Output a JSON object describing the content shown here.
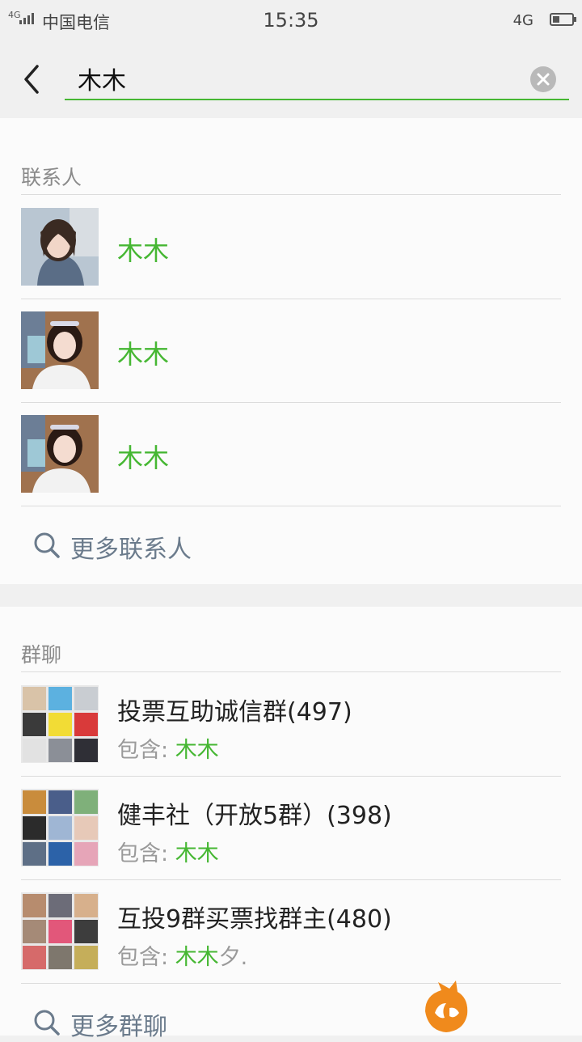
{
  "status_bar": {
    "signal": "4G",
    "carrier": "中国电信",
    "time": "15:35",
    "network": "4G"
  },
  "search": {
    "query": "木木",
    "back_icon": "back-arrow-icon",
    "clear_icon": "clear-icon"
  },
  "contacts": {
    "title": "联系人",
    "items": [
      {
        "name": "木木"
      },
      {
        "name": "木木"
      },
      {
        "name": "木木"
      }
    ],
    "more_label": "更多联系人"
  },
  "groups": {
    "title": "群聊",
    "items": [
      {
        "name": "投票互助诚信群(497)",
        "contains_label": "包含: ",
        "contains_match": "木木",
        "contains_rest": ""
      },
      {
        "name": "健丰社（开放5群）(398)",
        "contains_label": "包含: ",
        "contains_match": "木木",
        "contains_rest": ""
      },
      {
        "name": "互投9群买票找群主(480)",
        "contains_label": "包含: ",
        "contains_match": "木木",
        "contains_rest": "夕."
      }
    ],
    "more_label": "更多群聊"
  },
  "colors": {
    "accent_green": "#46b733",
    "watermark_orange": "#f08a1c"
  }
}
